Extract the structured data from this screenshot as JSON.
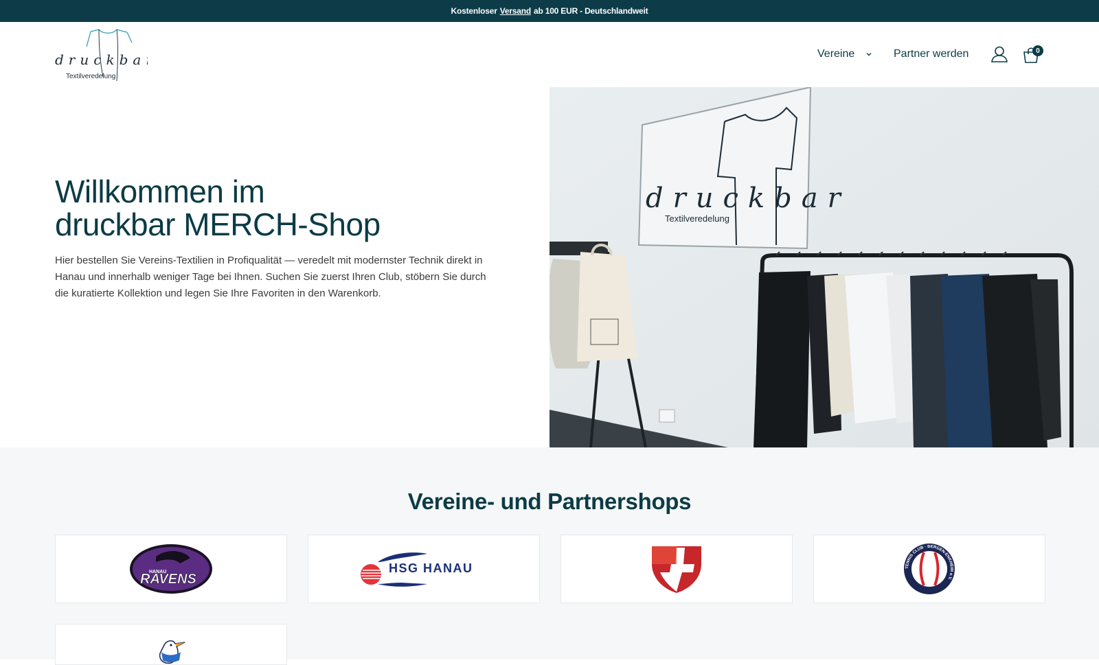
{
  "announcement": {
    "prefix": "Kostenloser",
    "link": "Versand",
    "suffix": "ab 100 EUR - Deutschlandweit"
  },
  "header": {
    "logo_text": "druckbar",
    "logo_subtext": "Textilveredelung",
    "nav": {
      "vereine": "Vereine",
      "partner": "Partner werden"
    },
    "cart_count": "0"
  },
  "hero": {
    "title_line1": "Willkommen im",
    "title_line2": "druckbar MERCH-Shop",
    "text": "Hier bestellen Sie Vereins-Textilien in Profiqualität — veredelt mit modernster Technik direkt in Hanau und innerhalb weniger Tage bei Ihnen. Suchen Sie zuerst Ihren Club, stöbern Sie durch die kuratierte Kollektion und legen Sie Ihre Favoriten in den Warenkorb.",
    "image_sign_text": "druckbar",
    "image_sign_subtext": "Textilveredelung"
  },
  "shops": {
    "title": "Vereine- und Partnershops",
    "items": [
      {
        "logo_text_top": "HANAU",
        "logo_text": "RAVENS"
      },
      {
        "logo_text": "HSG HANAU"
      },
      {
        "logo_text": ""
      },
      {
        "logo_text_ring": "TENNIS CLUB · BERGEN-ENKHEIM e.V."
      },
      {
        "logo_text": ""
      }
    ]
  },
  "colors": {
    "primary": "#0d3c48",
    "background_alt": "#f5f7f8",
    "text_body": "#3a3a3a"
  },
  "icons": [
    "chevron-down-icon",
    "account-icon",
    "cart-icon"
  ]
}
